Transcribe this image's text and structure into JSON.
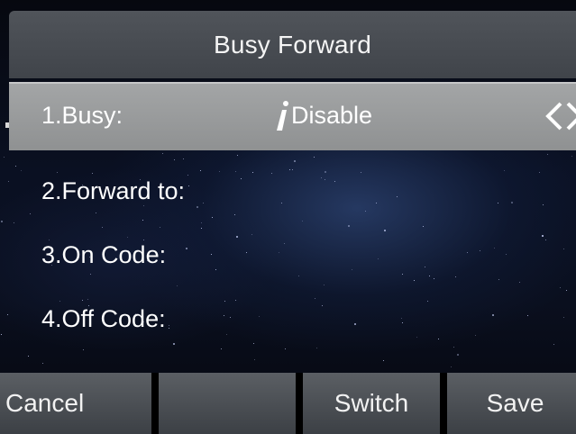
{
  "header": {
    "title": "Busy Forward"
  },
  "rows": [
    {
      "label": "1.Busy:",
      "value": "Disable",
      "selected": true
    },
    {
      "label": "2.Forward to:"
    },
    {
      "label": "3.On Code:"
    },
    {
      "label": "4.Off Code:"
    }
  ],
  "icons": {
    "info": "info-icon",
    "switch_arrows": "left-right-arrows-icon"
  },
  "softkeys": [
    {
      "label": "Cancel"
    },
    {
      "label": ""
    },
    {
      "label": "Switch"
    },
    {
      "label": "Save"
    }
  ],
  "colors": {
    "title_bar": "#45494e",
    "selected_row": "#999b9c",
    "softkey": "#4a4e53",
    "text": "#ffffff"
  }
}
